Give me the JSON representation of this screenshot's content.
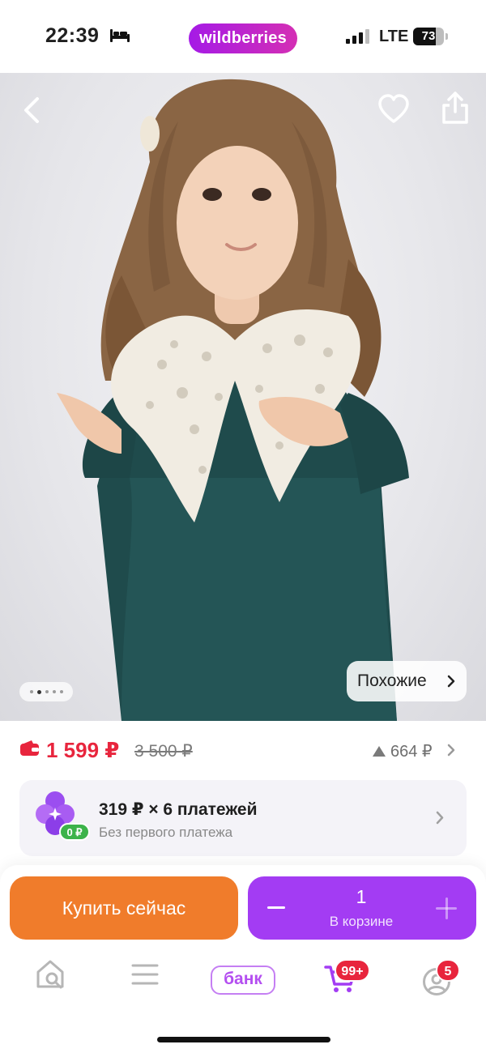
{
  "status_bar": {
    "time": "22:39",
    "brand": "wildberries",
    "network": "LTE",
    "battery_percent": "73",
    "battery_level": 0.73,
    "icons": [
      "bed-icon",
      "signal-icon",
      "battery-icon"
    ]
  },
  "product_photo": {
    "back_icon": "chevron-left-icon",
    "favorite_icon": "heart-icon",
    "share_icon": "share-icon",
    "carousel": {
      "total": 5,
      "current": 2
    },
    "similar_label": "Похожие"
  },
  "price": {
    "current": "1 599 ₽",
    "old": "3 500 ₽",
    "delta": "664 ₽",
    "colors": {
      "current": "#e8253d",
      "old": "#7b7b7b"
    }
  },
  "installment": {
    "main": "319 ₽ × 6 платежей",
    "sub": "Без первого платежа",
    "logo_badge": "0 ₽"
  },
  "actions": {
    "buy_now": "Купить сейчас",
    "quantity": "1",
    "in_cart": "В корзине",
    "colors": {
      "buy": "#f07c2b",
      "cart": "#a33cf3"
    }
  },
  "tab_bar": {
    "bank_label": "банк",
    "cart_badge": "99+",
    "profile_badge": "5"
  }
}
